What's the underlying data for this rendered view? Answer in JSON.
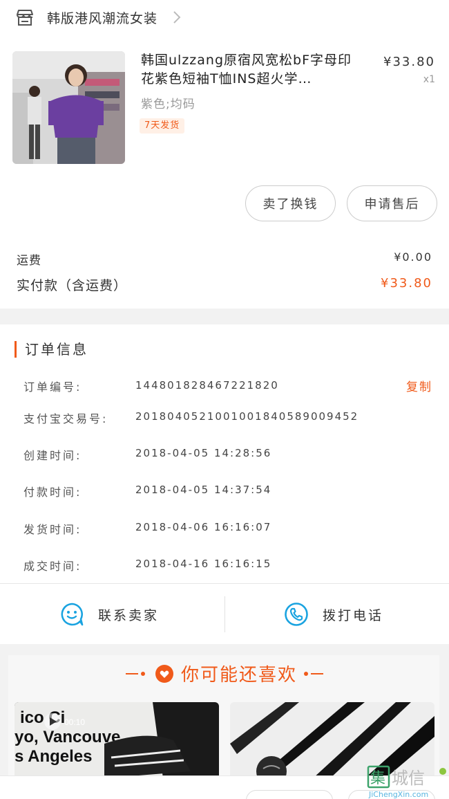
{
  "shop": {
    "name": "韩版港风潮流女装",
    "icon": "store-icon"
  },
  "product": {
    "title": "韩国ulzzang原宿风宽松bF字母印花紫色短袖T恤INS超火学…",
    "sku": "紫色;均码",
    "badge": "7天发货",
    "price": "¥33.80",
    "qty": "x1"
  },
  "actions": {
    "sell_label": "卖了换钱",
    "aftersale_label": "申请售后"
  },
  "fees": {
    "shipping_label": "运费",
    "shipping_value": "¥0.00",
    "total_label": "实付款（含运费）",
    "total_value": "¥33.80"
  },
  "order": {
    "title": "订单信息",
    "copy_label": "复制",
    "rows": [
      {
        "label": "订单编号:",
        "value": "144801828467221820"
      },
      {
        "label": "支付宝交易号:",
        "value": "2018040521001001840589009452"
      },
      {
        "label": "创建时间:",
        "value": "2018-04-05  14:28:56"
      },
      {
        "label": "付款时间:",
        "value": "2018-04-05  14:37:54"
      },
      {
        "label": "发货时间:",
        "value": "2018-04-06  16:16:07"
      },
      {
        "label": "成交时间:",
        "value": "2018-04-16  16:16:15"
      }
    ]
  },
  "contact": {
    "chat_label": "联系卖家",
    "call_label": "拨打电话"
  },
  "recommend": {
    "title": "你可能还喜欢",
    "items": [
      {
        "image": "sneakers-photo",
        "overlay_text": "ico Ci yo, Vancouve s Angeles",
        "video_time": "00:10"
      },
      {
        "image": "mascara-photo"
      }
    ]
  },
  "watermark": {
    "text": "集城信",
    "url": "JiChengXin.com"
  },
  "colors": {
    "accent": "#f05a1a",
    "blue_icon": "#1aa3e0"
  }
}
